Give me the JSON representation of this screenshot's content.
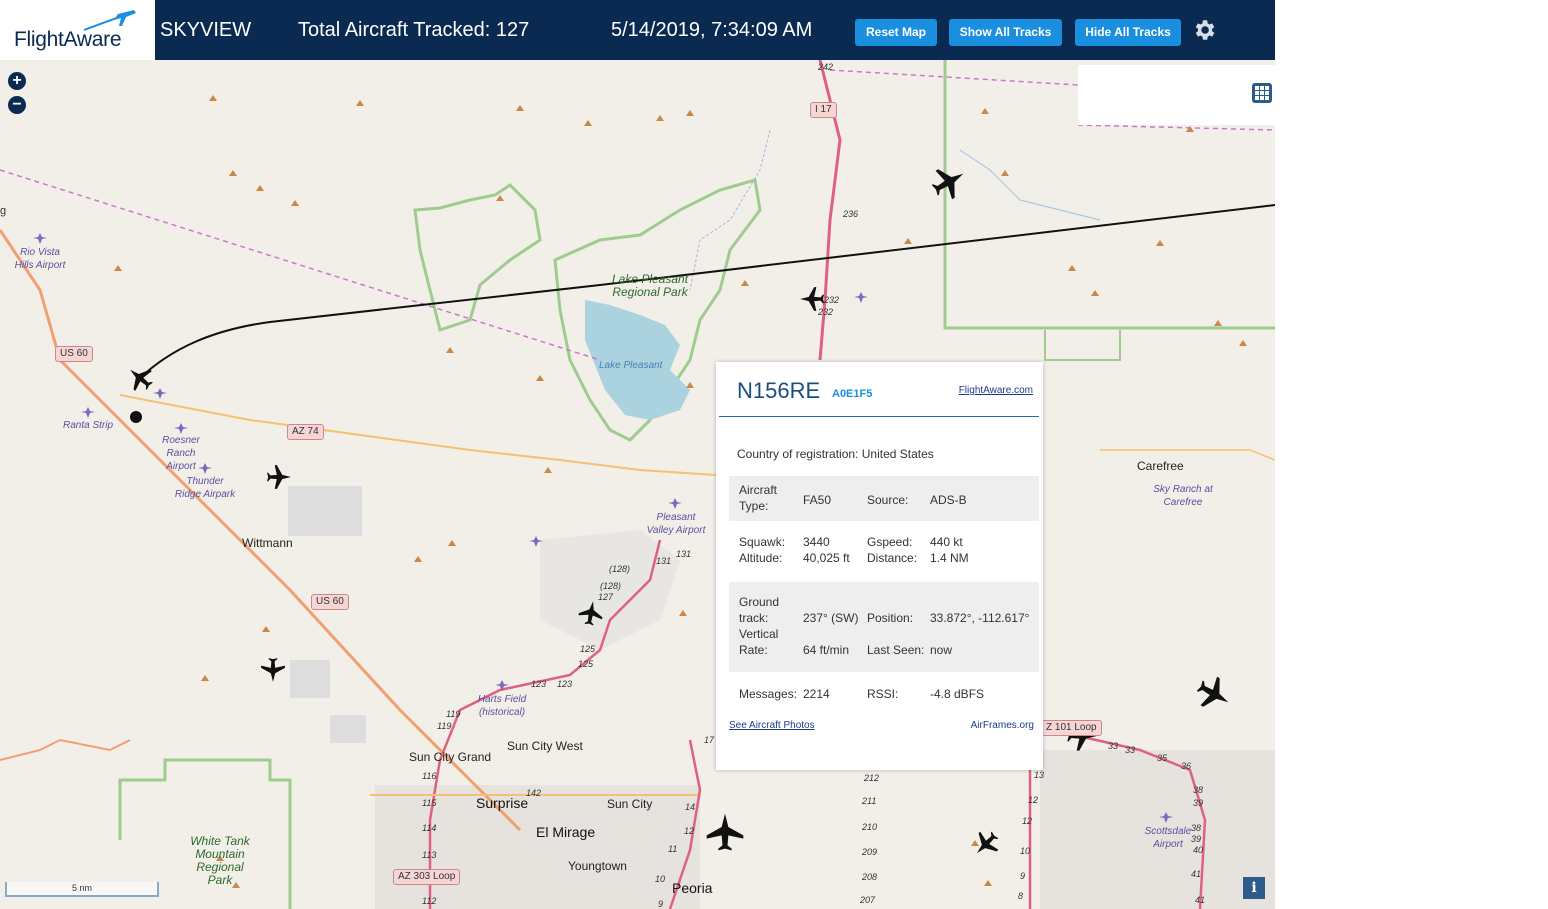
{
  "header": {
    "logo": "FlightAware",
    "title": "SKYVIEW",
    "total_tracked": "Total Aircraft Tracked: 127",
    "datetime": "5/14/2019, 7:34:09 AM",
    "reset_label": "Reset Map",
    "show_tracks_label": "Show All Tracks",
    "hide_tracks_label": "Hide All Tracks",
    "settings_icon": "gear-icon"
  },
  "map": {
    "zoom_in": "+",
    "zoom_out": "−",
    "scale": "5 nm",
    "info": "i",
    "labels": {
      "carefree": "Carefree",
      "wittmann": "Wittmann",
      "surprise": "Surprise",
      "el_mirage": "El Mirage",
      "sun_city": "Sun City",
      "sun_city_west": "Sun City West",
      "sun_city_grand": "Sun City Grand",
      "youngtown": "Youngtown",
      "peoria": "Peoria",
      "lake_pleasant_park": "Lake Pleasant Regional Park",
      "lake_pleasant": "Lake Pleasant",
      "white_tank": "White Tank Mountain Regional Park",
      "rio_vista": "Rio Vista Hills Airport",
      "ranta": "Ranta Strip",
      "roesner": "Roesner Ranch Airport",
      "thunder_ridge": "Thunder Ridge Airpark",
      "pleasant_valley": "Pleasant Valley Airport",
      "harts_field": "Harts Field (historical)",
      "sky_ranch": "Sky Ranch at Carefree",
      "scottsdale": "Scottsdale Airport",
      "edge_g": "g"
    },
    "shields": {
      "us60_a": "US 60",
      "us60_b": "US 60",
      "az74": "AZ 74",
      "i17": "I 17",
      "az303": "AZ 303 Loop",
      "az101": "Z 101 Loop"
    },
    "road_numbers": [
      "242",
      "236",
      "232",
      "232",
      "131",
      "131",
      "(128)",
      "(128)",
      "127",
      "125",
      "125",
      "123",
      "123",
      "119",
      "119",
      "116",
      "115",
      "114",
      "113",
      "112",
      "142",
      "17",
      "14",
      "12",
      "11",
      "10",
      "9",
      "212",
      "211",
      "210",
      "209",
      "208",
      "207",
      "13",
      "12",
      "12",
      "10",
      "9",
      "8",
      "33",
      "33",
      "35",
      "36",
      "38",
      "39",
      "38",
      "39",
      "40",
      "41",
      "41"
    ]
  },
  "popup": {
    "ident": "N156RE",
    "hex": "A0E1F5",
    "fa_link": "FlightAware.com",
    "country_label": "Country of registration:",
    "country_value": "United States",
    "aircraft_type_label": "Aircraft Type:",
    "aircraft_type_value": "FA50",
    "source_label": "Source:",
    "source_value": "ADS-B",
    "squawk_label": "Squawk:",
    "squawk_value": "3440",
    "gspeed_label": "Gspeed:",
    "gspeed_value": "440 kt",
    "altitude_label": "Altitude:",
    "altitude_value": "40,025 ft",
    "distance_label": "Distance:",
    "distance_value": "1.4 NM",
    "ground_track_label": "Ground track:",
    "ground_track_value": "237° (SW)",
    "position_label": "Position:",
    "position_value": "33.872°, -112.617°",
    "vertical_rate_label": "Vertical Rate:",
    "vertical_rate_value": "64 ft/min",
    "last_seen_label": "Last Seen:",
    "last_seen_value": "now",
    "messages_label": "Messages:",
    "messages_value": "2214",
    "rssi_label": "RSSI:",
    "rssi_value": "-4.8 dBFS",
    "photos_link": "See Aircraft Photos",
    "airframes_link": "AirFrames.org"
  }
}
